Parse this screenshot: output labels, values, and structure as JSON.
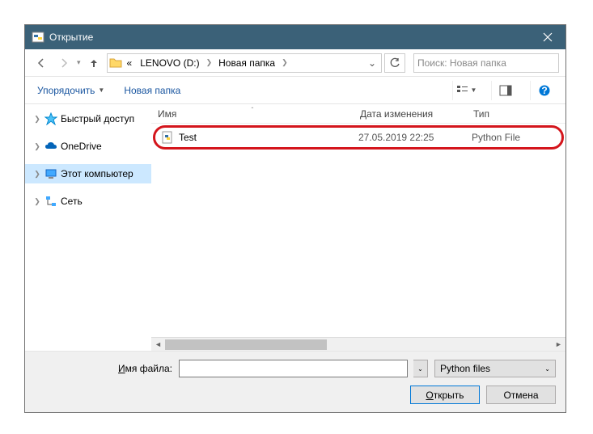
{
  "title": "Открытие",
  "breadcrumbs": {
    "drive": "LENOVO (D:)",
    "folder": "Новая папка",
    "prefix": "«"
  },
  "search_placeholder": "Поиск: Новая папка",
  "toolbar": {
    "organize": "Упорядочить",
    "new_folder": "Новая папка"
  },
  "navpane": {
    "quick_access": "Быстрый доступ",
    "onedrive": "OneDrive",
    "this_pc": "Этот компьютер",
    "network": "Сеть"
  },
  "columns": {
    "name": "Имя",
    "date": "Дата изменения",
    "type": "Тип"
  },
  "files": [
    {
      "name": "Test",
      "date": "27.05.2019 22:25",
      "type": "Python File"
    }
  ],
  "filename_label_prefix": "И",
  "filename_label_rest": "мя файла:",
  "filetype": "Python files",
  "buttons": {
    "open": "Открыть",
    "cancel": "Отмена"
  }
}
